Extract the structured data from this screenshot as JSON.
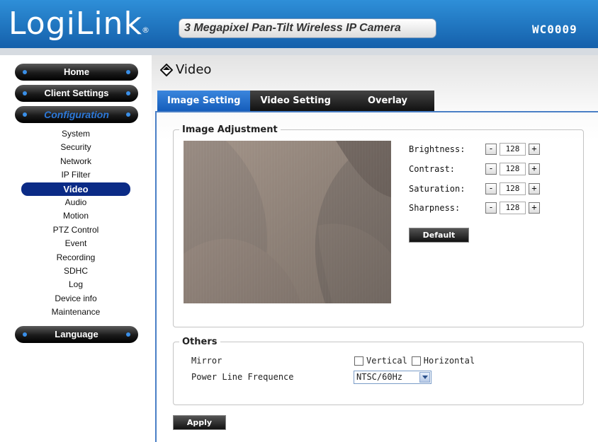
{
  "header": {
    "logo": "LogiLink",
    "logo_mark": "®",
    "product": "3 Megapixel Pan-Tilt Wireless IP Camera",
    "model": "WC0009"
  },
  "sidebar": {
    "home": "Home",
    "client_settings": "Client Settings",
    "configuration": "Configuration",
    "language": "Language",
    "items": [
      "System",
      "Security",
      "Network",
      "IP Filter",
      "Video",
      "Audio",
      "Motion",
      "PTZ Control",
      "Event",
      "Recording",
      "SDHC",
      "Log",
      "Device info",
      "Maintenance"
    ],
    "active_item": "Video"
  },
  "page": {
    "title": "Video",
    "tabs": [
      "Image Setting",
      "Video Setting",
      "Overlay"
    ],
    "active_tab": "Image Setting"
  },
  "image_adjustment": {
    "legend": "Image Adjustment",
    "rows": [
      {
        "label": "Brightness:",
        "value": "128"
      },
      {
        "label": "Contrast:",
        "value": "128"
      },
      {
        "label": "Saturation:",
        "value": "128"
      },
      {
        "label": "Sharpness:",
        "value": "128"
      }
    ],
    "minus": "-",
    "plus": "+",
    "default_button": "Default"
  },
  "others": {
    "legend": "Others",
    "mirror_label": "Mirror",
    "vertical": "Vertical",
    "horizontal": "Horizontal",
    "vertical_checked": false,
    "horizontal_checked": false,
    "power_line_label": "Power Line Frequence",
    "power_line_value": "NTSC/60Hz"
  },
  "apply_button": "Apply",
  "colors": {
    "header_blue": "#1d73c4",
    "tab_active": "#2a74cf",
    "nav_active": "#0b2b86"
  }
}
